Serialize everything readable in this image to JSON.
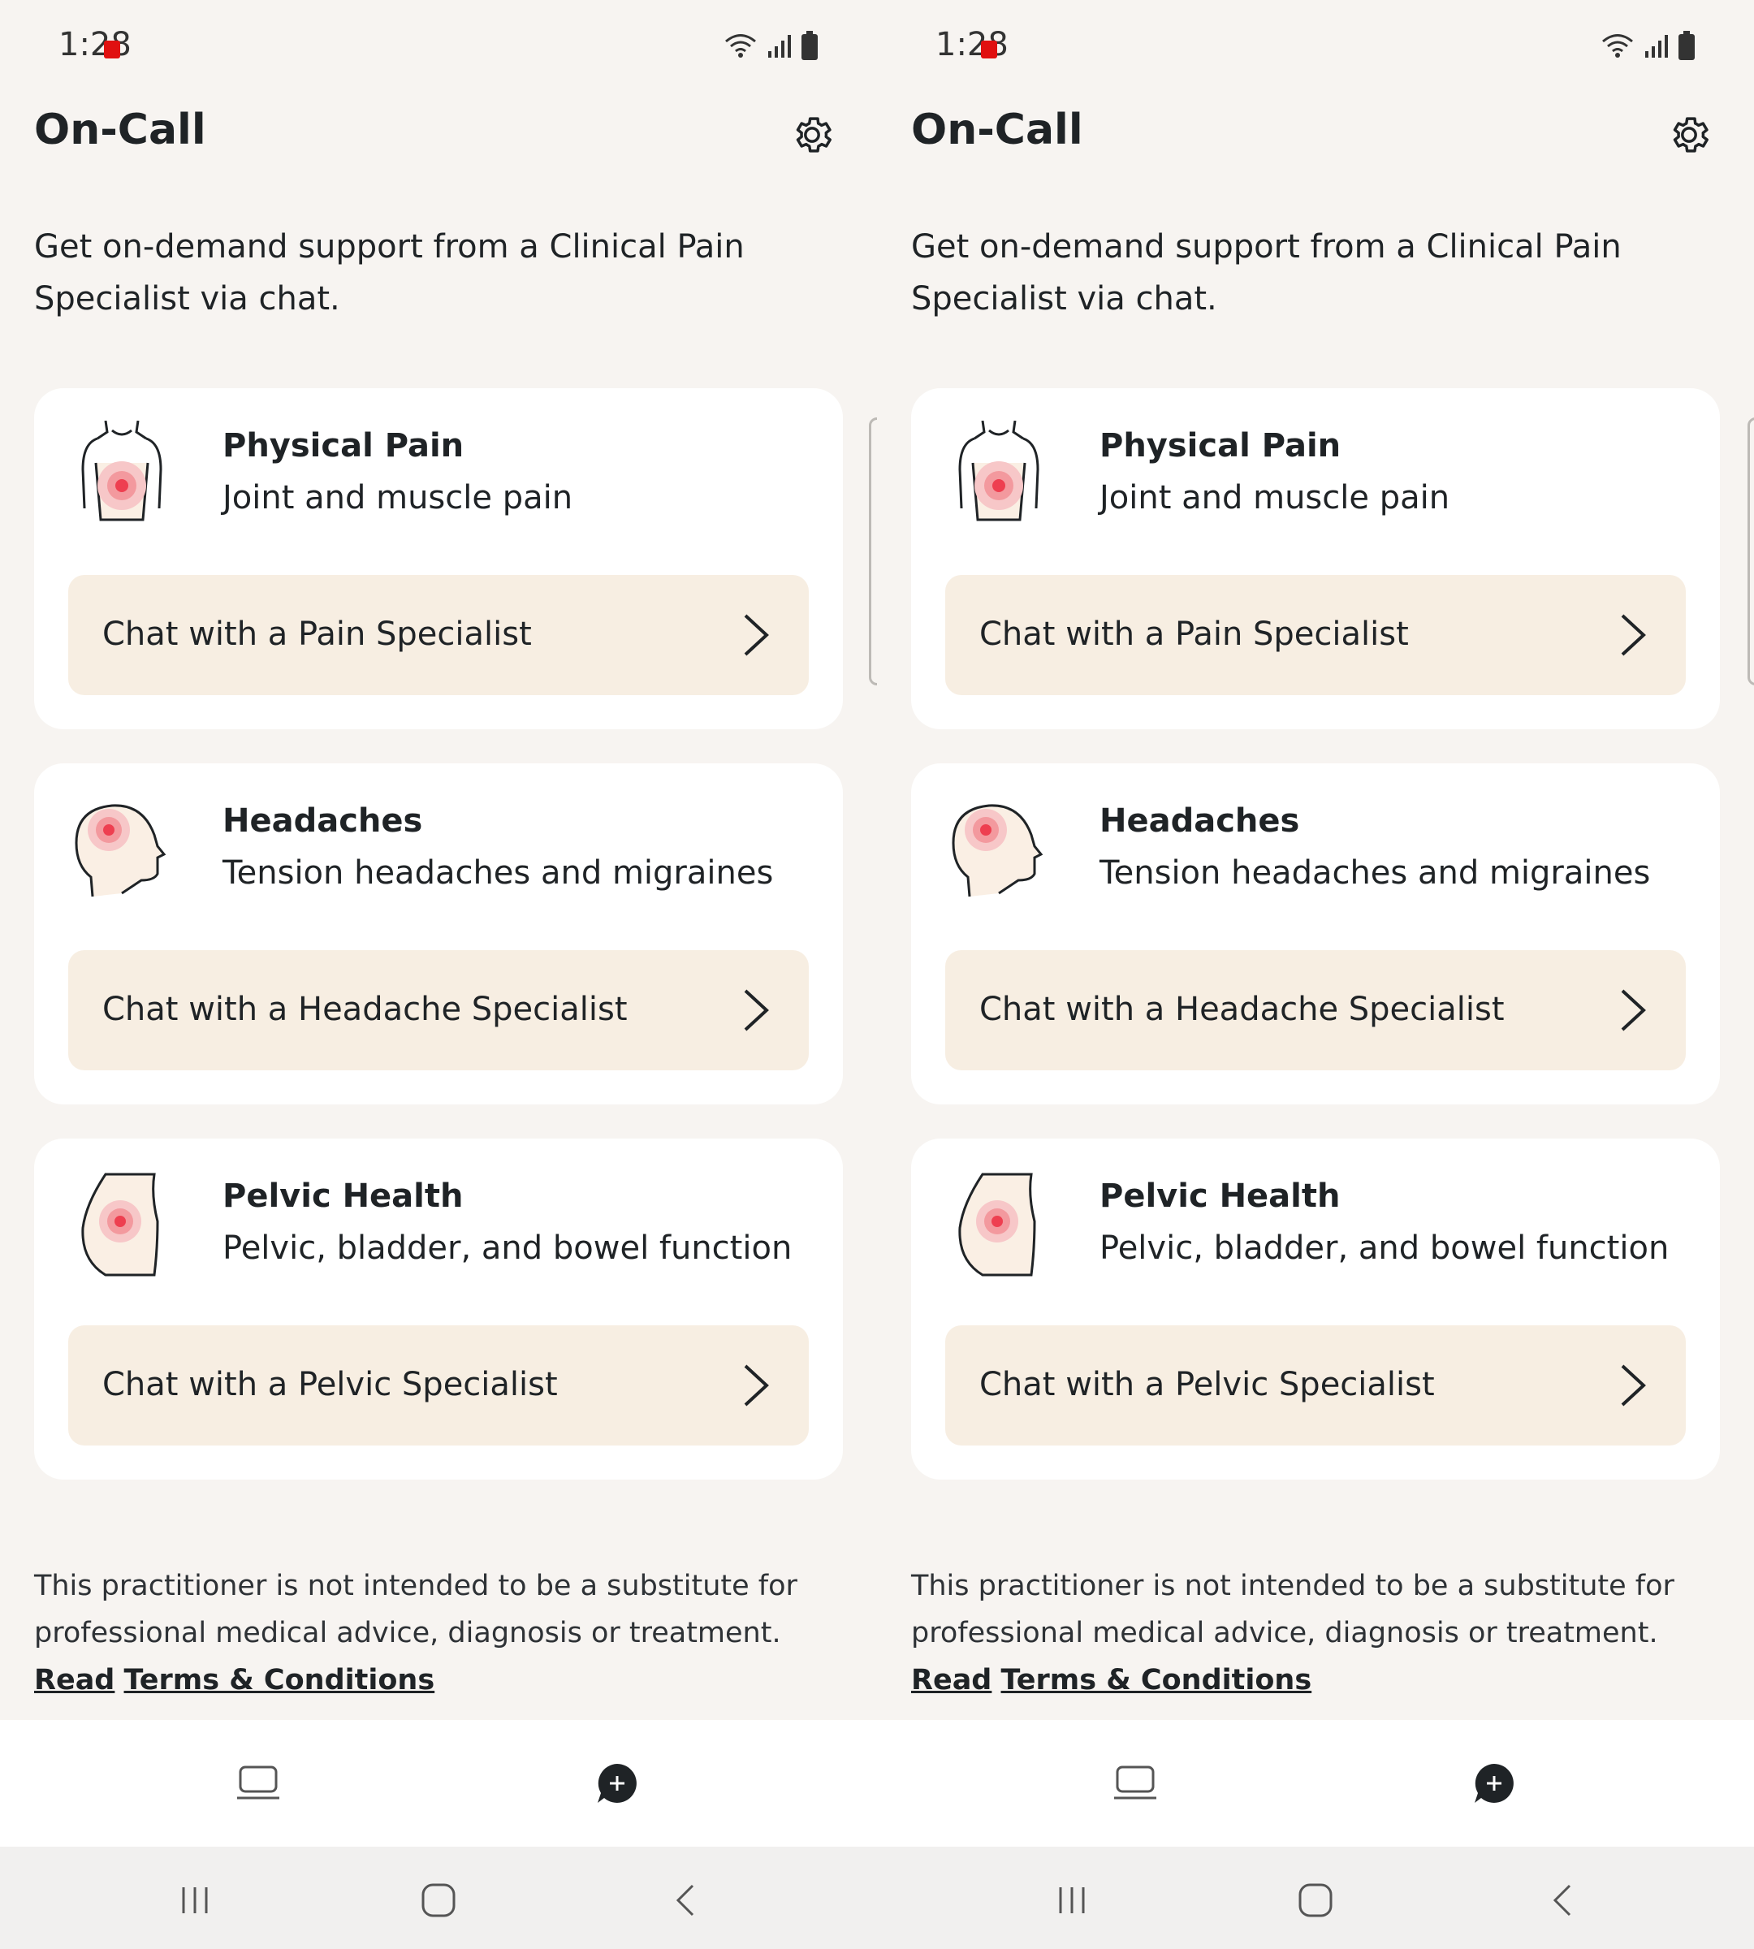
{
  "status": {
    "time": "1:28"
  },
  "app": {
    "title": "On-Call",
    "intro": "Get on-demand support from a Clinical Pain Specialist via chat."
  },
  "cards": [
    {
      "icon": "torso-pain-icon",
      "title": "Physical Pain",
      "subtitle": "Joint and muscle pain",
      "cta": "Chat with a Pain Specialist"
    },
    {
      "icon": "head-pain-icon",
      "title": "Headaches",
      "subtitle": "Tension headaches and migraines",
      "cta": "Chat with a Headache Specialist"
    },
    {
      "icon": "pelvic-pain-icon",
      "title": "Pelvic Health",
      "subtitle": "Pelvic, bladder, and bowel function",
      "cta": "Chat with a Pelvic Specialist"
    }
  ],
  "disclaimer": {
    "text": "This practitioner is not intended to be a substitute for professional medical advice, diagnosis or treatment.",
    "link_word": "Read",
    "link_rest": "Terms & Conditions"
  },
  "bottom_nav": {
    "items": [
      "laptop-icon",
      "chat-plus-icon"
    ]
  },
  "system_nav": {
    "items": [
      "recents-icon",
      "home-icon",
      "back-icon"
    ]
  },
  "colors": {
    "background": "#f7f4f1",
    "card": "#ffffff",
    "cta": "#f7eee2",
    "text": "#1f2326",
    "pain_accent": "#f0475a"
  }
}
